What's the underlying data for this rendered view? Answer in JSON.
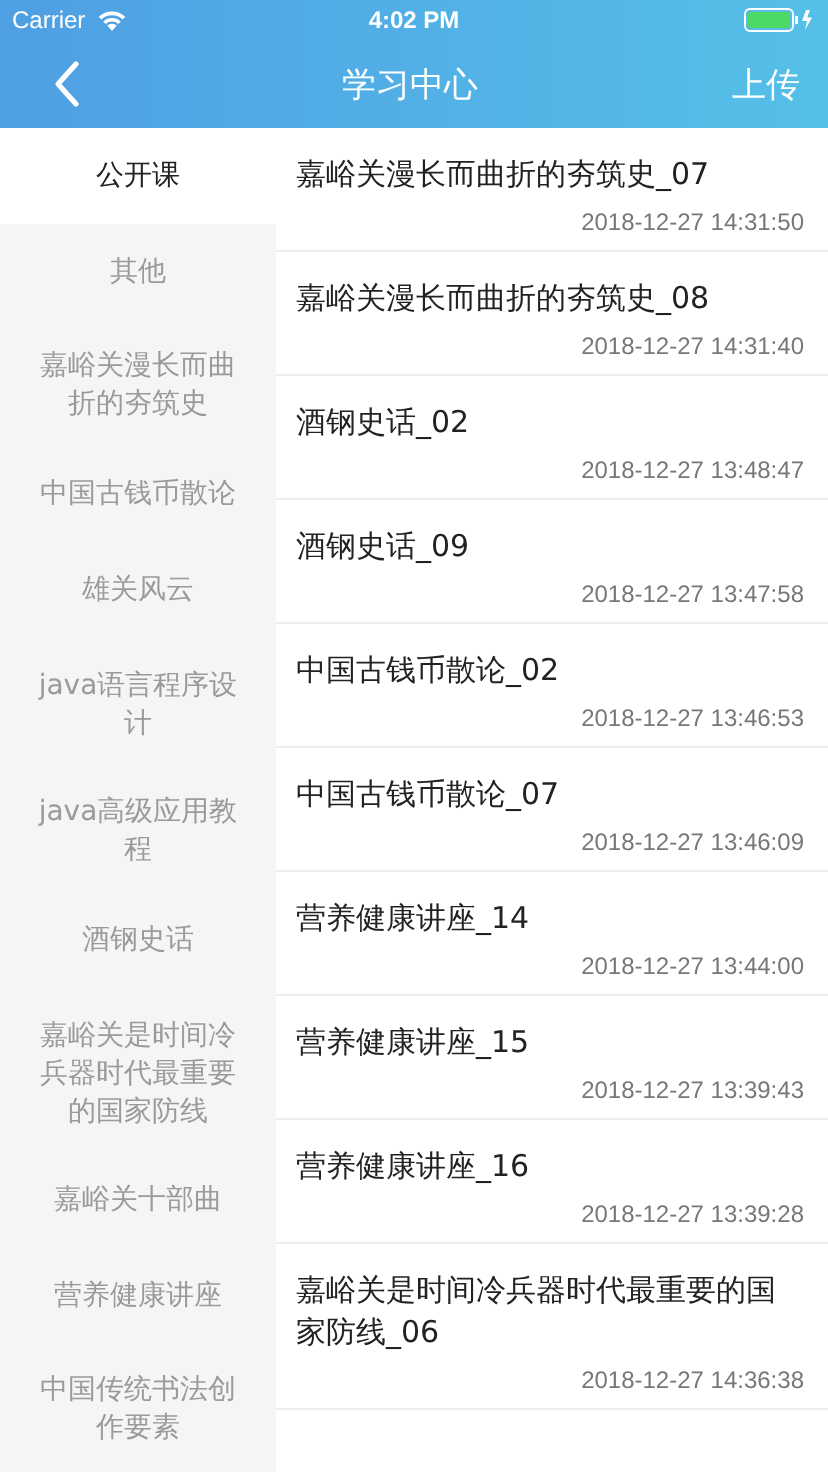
{
  "status_bar": {
    "carrier": "Carrier",
    "time": "4:02 PM"
  },
  "nav_bar": {
    "title": "学习中心",
    "action": "上传"
  },
  "categories": [
    {
      "label": "公开课",
      "selected": true
    },
    {
      "label": "其他",
      "selected": false
    },
    {
      "label": "嘉峪关漫长而曲折的夯筑史",
      "selected": false
    },
    {
      "label": "中国古钱币散论",
      "selected": false
    },
    {
      "label": "雄关风云",
      "selected": false
    },
    {
      "label": "java语言程序设计",
      "selected": false
    },
    {
      "label": "java高级应用教程",
      "selected": false
    },
    {
      "label": "酒钢史话",
      "selected": false
    },
    {
      "label": "嘉峪关是时间冷兵器时代最重要的国家防线",
      "selected": false
    },
    {
      "label": "嘉峪关十部曲",
      "selected": false
    },
    {
      "label": "营养健康讲座",
      "selected": false
    },
    {
      "label": "中国传统书法创作要素",
      "selected": false
    }
  ],
  "courses": [
    {
      "title": "嘉峪关漫长而曲折的夯筑史_07",
      "date": "2018-12-27 14:31:50"
    },
    {
      "title": "嘉峪关漫长而曲折的夯筑史_08",
      "date": "2018-12-27 14:31:40"
    },
    {
      "title": "酒钢史话_02",
      "date": "2018-12-27 13:48:47"
    },
    {
      "title": "酒钢史话_09",
      "date": "2018-12-27 13:47:58"
    },
    {
      "title": "中国古钱币散论_02",
      "date": "2018-12-27 13:46:53"
    },
    {
      "title": "中国古钱币散论_07",
      "date": "2018-12-27 13:46:09"
    },
    {
      "title": "营养健康讲座_14",
      "date": "2018-12-27 13:44:00"
    },
    {
      "title": "营养健康讲座_15",
      "date": "2018-12-27 13:39:43"
    },
    {
      "title": "营养健康讲座_16",
      "date": "2018-12-27 13:39:28"
    },
    {
      "title": "嘉峪关是时间冷兵器时代最重要的国家防线_06",
      "date": "2018-12-27 14:36:38"
    }
  ]
}
